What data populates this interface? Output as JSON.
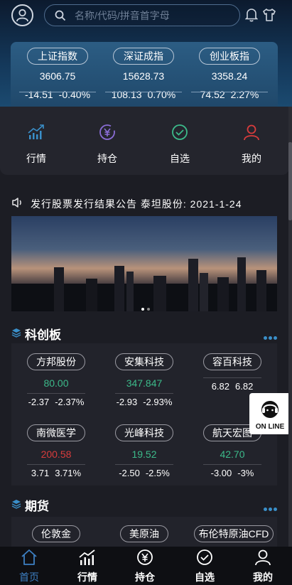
{
  "search": {
    "placeholder": "名称/代码/拼音首字母"
  },
  "indices": [
    {
      "name": "上证指数",
      "value": "3606.75",
      "change": "-14.51",
      "percent": "-0.40%"
    },
    {
      "name": "深证成指",
      "value": "15628.73",
      "change": "108.13",
      "percent": "0.70%"
    },
    {
      "name": "创业板指",
      "value": "3358.24",
      "change": "74.52",
      "percent": "2.27%"
    }
  ],
  "quick_menu": [
    {
      "label": "行情",
      "icon": "chart-icon"
    },
    {
      "label": "持仓",
      "icon": "yuan-coin-icon"
    },
    {
      "label": "自选",
      "icon": "check-circle-icon"
    },
    {
      "label": "我的",
      "icon": "user-icon"
    }
  ],
  "notice": {
    "text": "发行股票发行结果公告   泰坦股份: 2021-1-24"
  },
  "sections": {
    "kechuang": {
      "title": "科创板",
      "stocks": [
        {
          "name": "方邦股份",
          "price": "80.00",
          "change": "-2.37",
          "percent": "-2.37%",
          "color": "green"
        },
        {
          "name": "安集科技",
          "price": "347.847",
          "change": "-2.93",
          "percent": "-2.93%",
          "color": "green"
        },
        {
          "name": "容百科技",
          "price": "",
          "change": "6.82",
          "percent": "6.82",
          "color": "red"
        },
        {
          "name": "南微医学",
          "price": "200.58",
          "change": "3.71",
          "percent": "3.71%",
          "color": "red"
        },
        {
          "name": "光峰科技",
          "price": "19.52",
          "change": "-2.50",
          "percent": "-2.5%",
          "color": "green"
        },
        {
          "name": "航天宏图",
          "price": "42.70",
          "change": "-3.00",
          "percent": "-3%",
          "color": "green"
        }
      ]
    },
    "futures": {
      "title": "期货",
      "items": [
        {
          "name": "伦敦金"
        },
        {
          "name": "美原油"
        },
        {
          "name": "布伦特原油CFD"
        }
      ]
    }
  },
  "online": {
    "label": "ON LINE"
  },
  "tabbar": [
    {
      "label": "首页",
      "active": true,
      "icon": "home-icon"
    },
    {
      "label": "行情",
      "active": false,
      "icon": "chart-icon"
    },
    {
      "label": "持仓",
      "active": false,
      "icon": "yuan-coin-icon"
    },
    {
      "label": "自选",
      "active": false,
      "icon": "check-circle-icon"
    },
    {
      "label": "我的",
      "active": false,
      "icon": "user-icon"
    }
  ],
  "colors": {
    "green": "#3cba8a",
    "red": "#d83c3c",
    "accent": "#3d7fc2"
  }
}
